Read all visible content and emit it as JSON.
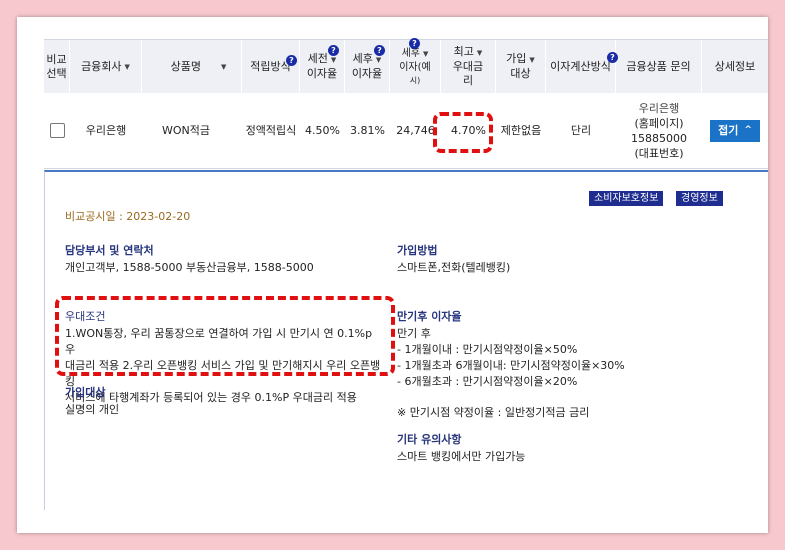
{
  "table": {
    "headers": {
      "compare": [
        "비교",
        "선택"
      ],
      "company": "금융회사",
      "product": "상품명",
      "method": "적립방식",
      "pretax": [
        "세전",
        "이자율"
      ],
      "aftertax": [
        "세후",
        "이자율"
      ],
      "aftertax_interest": [
        "세후",
        "이자(예",
        "시)"
      ],
      "max_rate": [
        "최고",
        "우대금",
        "리"
      ],
      "target": [
        "가입",
        "대상"
      ],
      "calc": "이자계산방식",
      "inquiry": "금융상품 문의",
      "detail": "상세정보"
    },
    "row": {
      "company": "우리은행",
      "product": "WON적금",
      "method": "정액적립식",
      "pretax_rate": "4.50%",
      "aftertax_rate": "3.81%",
      "aftertax_interest": "24,746",
      "max_rate": "4.70%",
      "target": "제한없음",
      "calc": "단리",
      "inquiry": [
        "우리은행",
        "(홈페이지)",
        "15885000",
        "(대표번호)"
      ],
      "fold_label": "접기"
    }
  },
  "detail": {
    "consumer_btn": "소비자보호정보",
    "management_btn": "경영정보",
    "disclosure_date": "비교공시일 : 2023-02-20",
    "dept_title": "담당부서 및 연락처",
    "dept_text": "개인고객부, 1588-5000 부동산금융부, 1588-5000",
    "join_method_title": "가입방법",
    "join_method_text": "스마트폰,전화(텔레뱅킹)",
    "preferential_title": "우대조건",
    "preferential_lines": [
      "1.WON통장, 우리 꿈통장으로 연결하여 가입 시 만기시 연 0.1%p 우",
      "대금리 적용 2.우리 오픈뱅킹 서비스 가입 및 만기해지시 우리 오픈뱅킹",
      "서비스에 타행계좌가 등록되어 있는 경우 0.1%P 우대금리 적용"
    ],
    "target_title": "가입대상",
    "target_text": "실명의 개인",
    "after_maturity_title": "만기후 이자율",
    "after_maturity_lines": [
      "만기 후",
      "- 1개월이내 : 만기시점약정이율×50%",
      "- 1개월초과 6개월이내: 만기시점약정이율×30%",
      "- 6개월초과 : 만기시점약정이율×20%"
    ],
    "maturity_note": "※ 만기시점 약정이율 : 일반정기적금 금리",
    "other_title": "기타 유의사항",
    "other_text": "스마트 뱅킹에서만 가입가능"
  },
  "colors": {
    "background": "#f7c9cf",
    "header_bg": "#eef0f5",
    "accent_blue": "#1b73c7",
    "navy": "#1e2d8f",
    "highlight_red": "#e01010",
    "date_brown": "#9a6a1e"
  },
  "icons": {
    "help": "question-circle-icon",
    "sort": "sort-down-icon",
    "fold": "chevron-up-icon"
  }
}
